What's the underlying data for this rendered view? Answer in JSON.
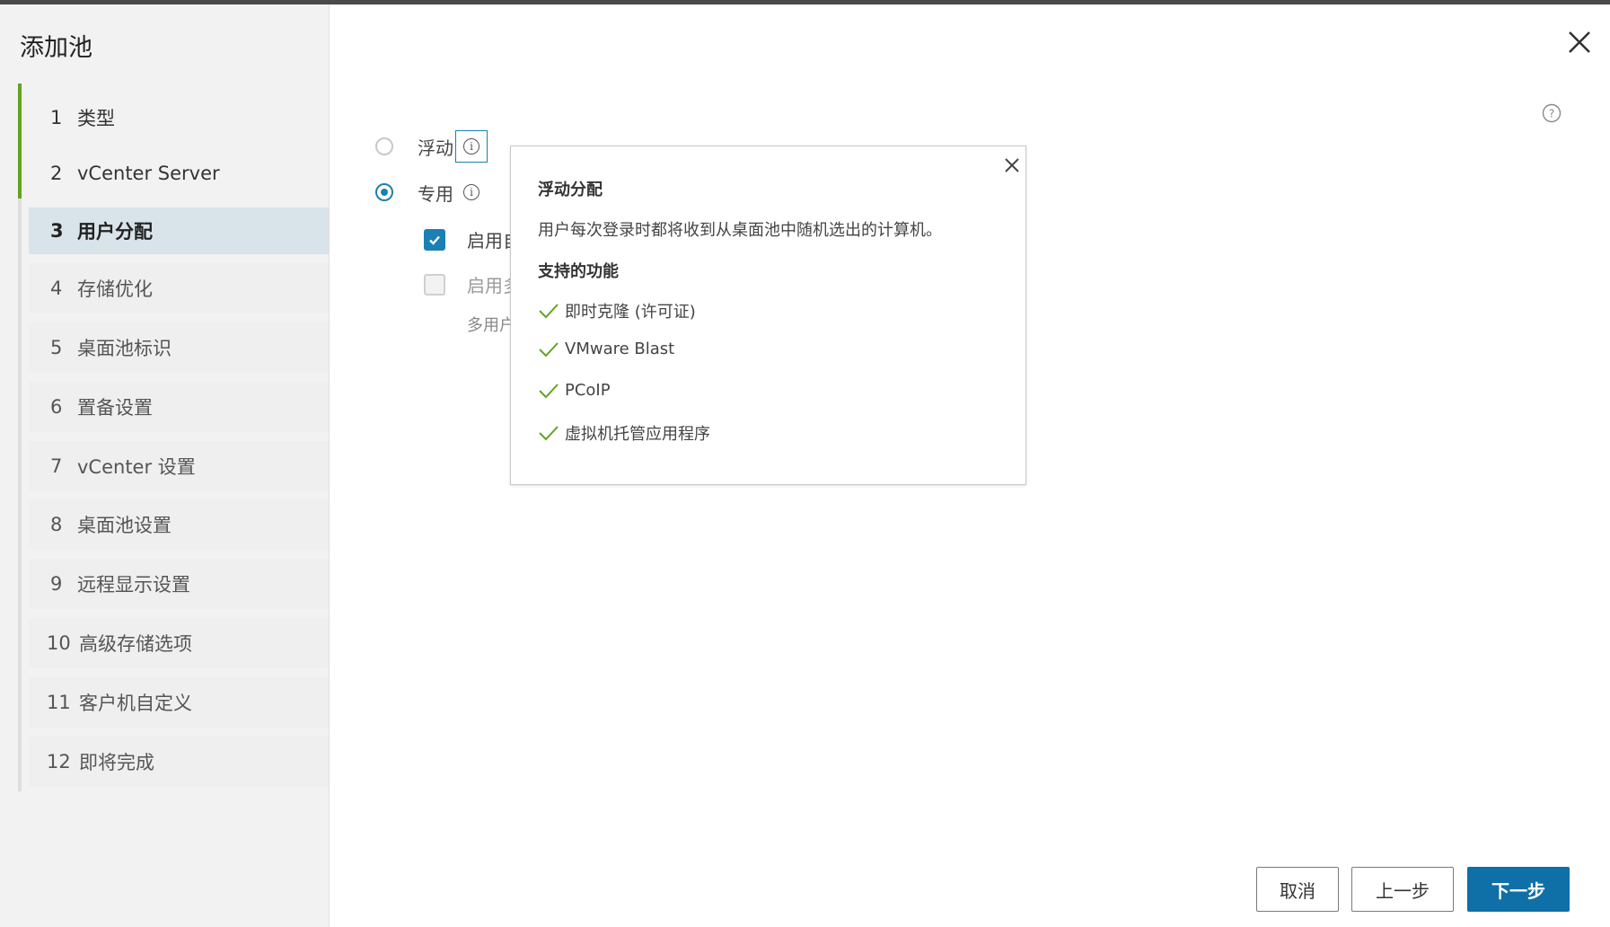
{
  "dialog": {
    "title": "添加池"
  },
  "steps": [
    {
      "num": "1",
      "label": "类型",
      "state": "done"
    },
    {
      "num": "2",
      "label": "vCenter Server",
      "state": "done"
    },
    {
      "num": "3",
      "label": "用户分配",
      "state": "active"
    },
    {
      "num": "4",
      "label": "存储优化",
      "state": "pending"
    },
    {
      "num": "5",
      "label": "桌面池标识",
      "state": "pending"
    },
    {
      "num": "6",
      "label": "置备设置",
      "state": "pending"
    },
    {
      "num": "7",
      "label": "vCenter 设置",
      "state": "pending"
    },
    {
      "num": "8",
      "label": "桌面池设置",
      "state": "pending"
    },
    {
      "num": "9",
      "label": "远程显示设置",
      "state": "pending"
    },
    {
      "num": "10",
      "label": "高级存储选项",
      "state": "pending"
    },
    {
      "num": "11",
      "label": "客户机自定义",
      "state": "pending"
    },
    {
      "num": "12",
      "label": "即将完成",
      "state": "pending"
    }
  ],
  "assignment": {
    "floating_label": "浮动",
    "dedicated_label": "专用",
    "selected": "dedicated",
    "option1_label": "启用自",
    "option1_checked": true,
    "option2_label": "启用多",
    "option2_checked": false,
    "hint": "多用户"
  },
  "popover": {
    "title": "浮动分配",
    "description": "用户每次登录时都将收到从桌面池中随机选出的计算机。",
    "features_heading": "支持的功能",
    "features": [
      "即时克隆 (许可证)",
      "VMware Blast",
      "PCoIP",
      "虚拟机托管应用程序"
    ]
  },
  "buttons": {
    "cancel": "取消",
    "back": "上一步",
    "next": "下一步"
  },
  "colors": {
    "accent": "#1a80b6",
    "primary_button": "#0f6fa7",
    "completed": "#62a420",
    "active_step_bg": "#d9e3ea"
  },
  "icons": {
    "close": "close-icon",
    "help": "help-icon",
    "info": "info-icon",
    "check": "check-icon"
  }
}
